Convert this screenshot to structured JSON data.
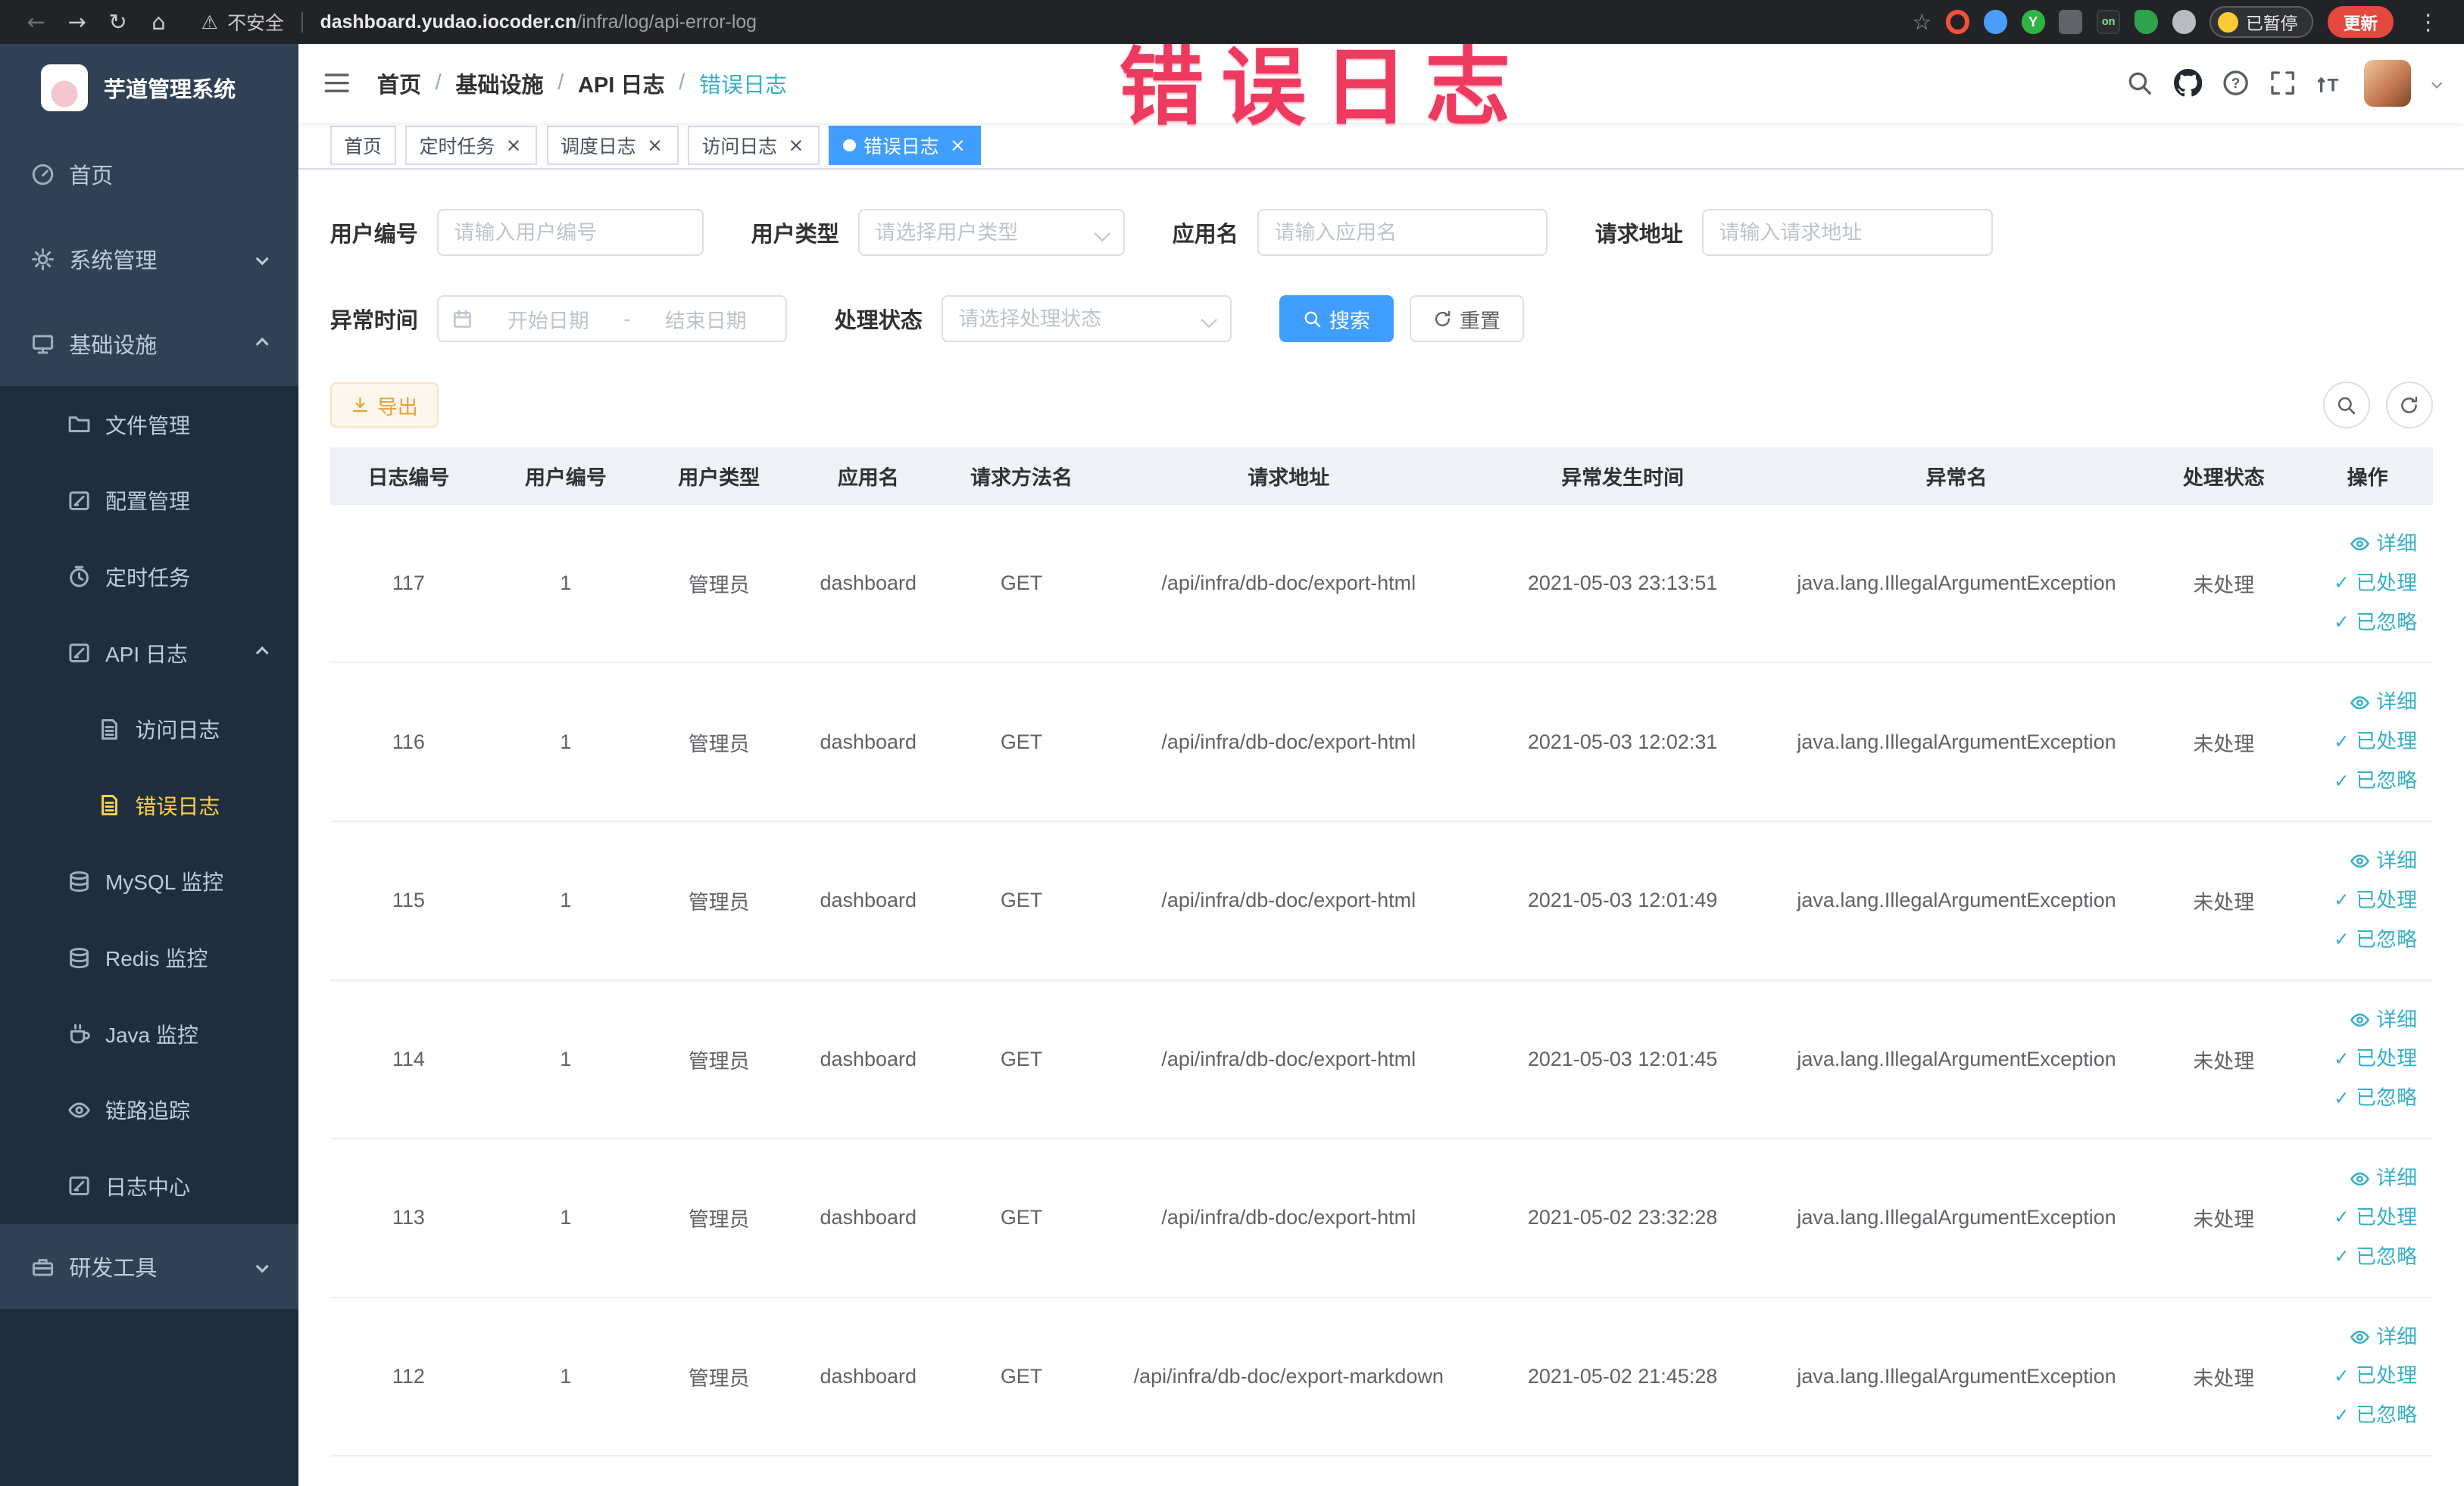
{
  "theme": {
    "primary": "#409eff",
    "link_color": "#38b0c9",
    "warning": "#e6a23c",
    "sidebar_active": "#ffd04b",
    "annotation_color": "#ee3a5f"
  },
  "browser": {
    "security_label": "不安全",
    "url_domain": "dashboard.yudao.iocoder.cn",
    "url_path": "/infra/log/api-error-log",
    "paused_label": "已暂停",
    "update_label": "更新",
    "extension_icons": [
      "star-icon",
      "record-icon",
      "drop-icon",
      "yudao-extension-icon",
      "puzzle-icon",
      "on-badge-icon",
      "leaf-icon",
      "paw-icon"
    ]
  },
  "sidebar": {
    "logo_title": "芋道管理系统",
    "menu": [
      {
        "id": "home",
        "label": "首页",
        "icon": "gauge-icon",
        "level": 0
      },
      {
        "id": "system-management",
        "label": "系统管理",
        "icon": "gear-icon",
        "level": 0,
        "chevron": "down"
      },
      {
        "id": "infrastructure",
        "label": "基础设施",
        "icon": "monitor-icon",
        "level": 0,
        "chevron": "up"
      },
      {
        "id": "file-management",
        "label": "文件管理",
        "icon": "folder-icon",
        "level": 1
      },
      {
        "id": "config-management",
        "label": "配置管理",
        "icon": "edit-icon",
        "level": 1
      },
      {
        "id": "scheduled-tasks",
        "label": "定时任务",
        "icon": "timer-icon",
        "level": 1
      },
      {
        "id": "api-log",
        "label": "API 日志",
        "icon": "edit-icon",
        "level": 1,
        "chevron": "up"
      },
      {
        "id": "access-log",
        "label": "访问日志",
        "icon": "doc-icon",
        "level": 2
      },
      {
        "id": "error-log",
        "label": "错误日志",
        "icon": "doc-icon",
        "level": 2,
        "active": true
      },
      {
        "id": "mysql-monitor",
        "label": "MySQL 监控",
        "icon": "database-icon",
        "level": 1
      },
      {
        "id": "redis-monitor",
        "label": "Redis 监控",
        "icon": "database-icon",
        "level": 1
      },
      {
        "id": "java-monitor",
        "label": "Java 监控",
        "icon": "coffee-icon",
        "level": 1
      },
      {
        "id": "trace",
        "label": "链路追踪",
        "icon": "eye-icon",
        "level": 1
      },
      {
        "id": "log-center",
        "label": "日志中心",
        "icon": "edit-icon",
        "level": 1
      },
      {
        "id": "dev-tools",
        "label": "研发工具",
        "icon": "toolbox-icon",
        "level": 0,
        "chevron": "down"
      }
    ]
  },
  "navbar": {
    "breadcrumb": [
      "首页",
      "基础设施",
      "API 日志",
      "错误日志"
    ],
    "icons": [
      "search-icon",
      "github-icon",
      "question-icon",
      "fullscreen-icon",
      "font-size-icon"
    ]
  },
  "tags_bar": {
    "tabs": [
      {
        "id": "home",
        "label": "首页",
        "closable": false,
        "active": false
      },
      {
        "id": "scheduled-tasks",
        "label": "定时任务",
        "closable": true,
        "active": false
      },
      {
        "id": "schedule-log",
        "label": "调度日志",
        "closable": true,
        "active": false
      },
      {
        "id": "access-log",
        "label": "访问日志",
        "closable": true,
        "active": false
      },
      {
        "id": "error-log",
        "label": "错误日志",
        "closable": true,
        "active": true
      }
    ]
  },
  "filters": {
    "user_id": {
      "label": "用户编号",
      "placeholder": "请输入用户编号"
    },
    "user_type": {
      "label": "用户类型",
      "placeholder": "请选择用户类型"
    },
    "app_name": {
      "label": "应用名",
      "placeholder": "请输入应用名"
    },
    "request_url": {
      "label": "请求地址",
      "placeholder": "请输入请求地址"
    },
    "exception_time": {
      "label": "异常时间",
      "start_placeholder": "开始日期",
      "separator": "-",
      "end_placeholder": "结束日期"
    },
    "process_status": {
      "label": "处理状态",
      "placeholder": "请选择处理状态"
    },
    "search_label": "搜索",
    "reset_label": "重置"
  },
  "toolbar": {
    "export_label": "导出"
  },
  "table": {
    "columns": [
      "日志编号",
      "用户编号",
      "用户类型",
      "应用名",
      "请求方法名",
      "请求地址",
      "异常发生时间",
      "异常名",
      "处理状态",
      "操作"
    ],
    "column_ids": [
      "log-id",
      "user-id",
      "user-type",
      "app-name",
      "method",
      "url",
      "time",
      "exception",
      "status",
      "actions"
    ],
    "row_actions": [
      "详细",
      "已处理",
      "已忽略"
    ],
    "rows": [
      {
        "log_id": "117",
        "user_id": "1",
        "user_type": "管理员",
        "app_name": "dashboard",
        "method": "GET",
        "url": "/api/infra/db-doc/export-html",
        "time": "2021-05-03 23:13:51",
        "exception": "java.lang.IllegalArgumentException",
        "status": "未处理"
      },
      {
        "log_id": "116",
        "user_id": "1",
        "user_type": "管理员",
        "app_name": "dashboard",
        "method": "GET",
        "url": "/api/infra/db-doc/export-html",
        "time": "2021-05-03 12:02:31",
        "exception": "java.lang.IllegalArgumentException",
        "status": "未处理"
      },
      {
        "log_id": "115",
        "user_id": "1",
        "user_type": "管理员",
        "app_name": "dashboard",
        "method": "GET",
        "url": "/api/infra/db-doc/export-html",
        "time": "2021-05-03 12:01:49",
        "exception": "java.lang.IllegalArgumentException",
        "status": "未处理"
      },
      {
        "log_id": "114",
        "user_id": "1",
        "user_type": "管理员",
        "app_name": "dashboard",
        "method": "GET",
        "url": "/api/infra/db-doc/export-html",
        "time": "2021-05-03 12:01:45",
        "exception": "java.lang.IllegalArgumentException",
        "status": "未处理"
      },
      {
        "log_id": "113",
        "user_id": "1",
        "user_type": "管理员",
        "app_name": "dashboard",
        "method": "GET",
        "url": "/api/infra/db-doc/export-html",
        "time": "2021-05-02 23:32:28",
        "exception": "java.lang.IllegalArgumentException",
        "status": "未处理"
      },
      {
        "log_id": "112",
        "user_id": "1",
        "user_type": "管理员",
        "app_name": "dashboard",
        "method": "GET",
        "url": "/api/infra/db-doc/export-markdown",
        "time": "2021-05-02 21:45:28",
        "exception": "java.lang.IllegalArgumentException",
        "status": "未处理"
      }
    ]
  },
  "annotation": {
    "text": "错误日志"
  }
}
